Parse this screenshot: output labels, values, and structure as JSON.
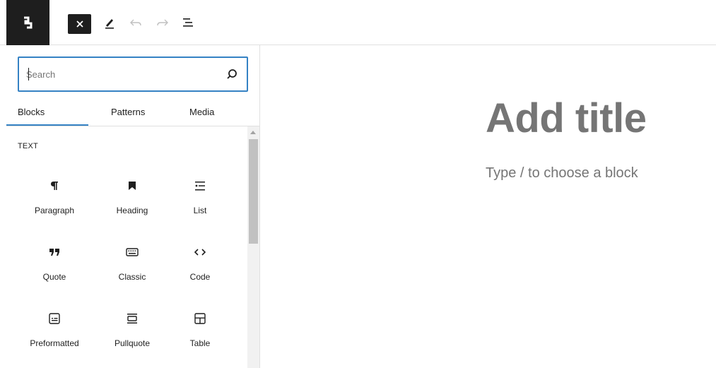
{
  "toolbar": {
    "logo_icon": "site-logo-icon",
    "close_icon": "close-icon",
    "tools_icon": "pencil-icon",
    "undo_icon": "undo-icon",
    "redo_icon": "redo-icon",
    "outline_icon": "list-view-icon"
  },
  "inserter": {
    "search_placeholder": "Search",
    "tabs": [
      {
        "label": "Blocks"
      },
      {
        "label": "Patterns"
      },
      {
        "label": "Media"
      }
    ],
    "active_tab": "Blocks",
    "category": "TEXT",
    "blocks": [
      {
        "label": "Paragraph",
        "icon": "paragraph-icon"
      },
      {
        "label": "Heading",
        "icon": "heading-icon"
      },
      {
        "label": "List",
        "icon": "list-icon"
      },
      {
        "label": "Quote",
        "icon": "quote-icon"
      },
      {
        "label": "Classic",
        "icon": "keyboard-icon"
      },
      {
        "label": "Code",
        "icon": "code-icon"
      },
      {
        "label": "Preformatted",
        "icon": "preformatted-icon"
      },
      {
        "label": "Pullquote",
        "icon": "pullquote-icon"
      },
      {
        "label": "Table",
        "icon": "table-icon"
      }
    ]
  },
  "editor": {
    "title_placeholder": "Add title",
    "block_placeholder": "Type / to choose a block"
  },
  "colors": {
    "accent": "#3582c4",
    "dark": "#1e1e1e",
    "muted": "#757575"
  }
}
